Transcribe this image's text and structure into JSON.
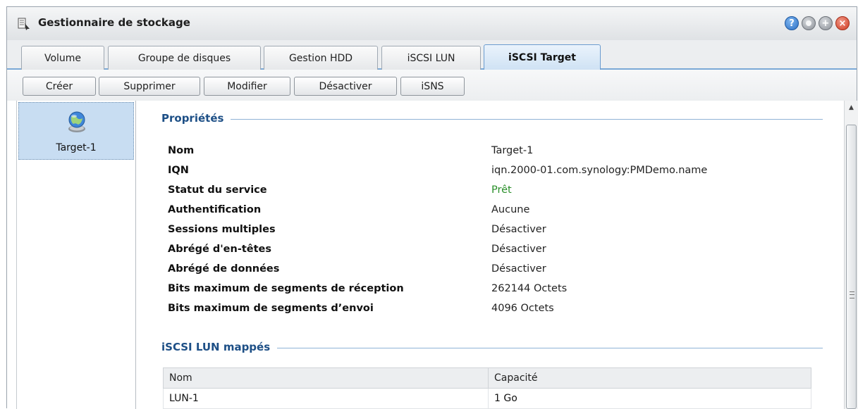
{
  "window": {
    "title": "Gestionnaire de stockage",
    "icon": "storage-manager-icon",
    "controls": [
      "help-icon",
      "minimize-icon",
      "maximize-icon",
      "close-icon"
    ]
  },
  "tabs": [
    {
      "label": "Volume",
      "active": false
    },
    {
      "label": "Groupe de disques",
      "active": false
    },
    {
      "label": "Gestion HDD",
      "active": false
    },
    {
      "label": "iSCSI LUN",
      "active": false
    },
    {
      "label": "iSCSI Target",
      "active": true
    }
  ],
  "toolbar": {
    "create": "Créer",
    "delete": "Supprimer",
    "edit": "Modifier",
    "disable": "Désactiver",
    "isns": "iSNS"
  },
  "sidebar": {
    "items": [
      {
        "label": "Target-1",
        "icon": "globe-target-icon",
        "selected": true
      }
    ]
  },
  "properties": {
    "heading": "Propriétés",
    "rows": [
      {
        "label": "Nom",
        "value": "Target-1"
      },
      {
        "label": "IQN",
        "value": "iqn.2000-01.com.synology:PMDemo.name"
      },
      {
        "label": "Statut du service",
        "value": "Prêt"
      },
      {
        "label": "Authentification",
        "value": "Aucune"
      },
      {
        "label": "Sessions multiples",
        "value": "Désactiver"
      },
      {
        "label": "Abrégé d'en-têtes",
        "value": "Désactiver"
      },
      {
        "label": "Abrégé de données",
        "value": "Désactiver"
      },
      {
        "label": "Bits maximum de segments de réception",
        "value": "262144 Octets"
      },
      {
        "label": "Bits maximum de segments d’envoi",
        "value": "4096 Octets"
      }
    ]
  },
  "mapped_luns": {
    "heading": "iSCSI LUN mappés",
    "columns": [
      "Nom",
      "Capacité"
    ],
    "rows": [
      {
        "name": "LUN-1",
        "capacity": "1 Go"
      }
    ]
  },
  "colors": {
    "status_ready": "#2a8f2a",
    "section_heading": "#1d4f86",
    "selection": "#c8ddf2"
  }
}
